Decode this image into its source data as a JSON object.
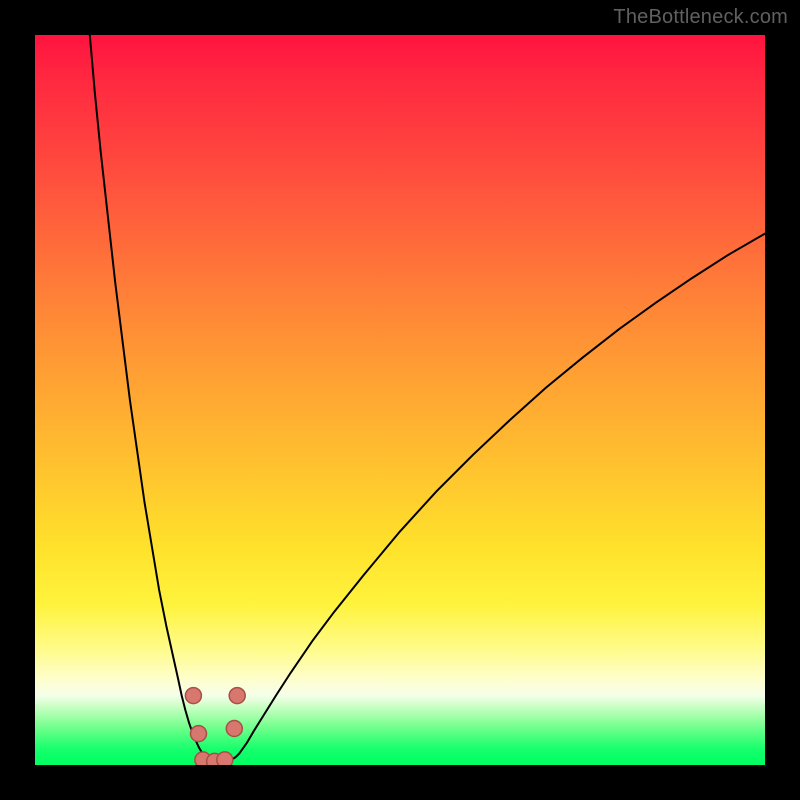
{
  "watermark": "TheBottleneck.com",
  "colors": {
    "page_bg": "#000000",
    "curve": "#000000",
    "marker_fill": "#d8776e",
    "marker_stroke": "#a84f47",
    "gradient_stops": [
      "#ff133f",
      "#ff2840",
      "#ff4a3e",
      "#ff6f3a",
      "#ff9934",
      "#ffbf2f",
      "#ffe12b",
      "#fff33d",
      "#fffb88",
      "#fdfed0",
      "#f4ffe9",
      "#caffc4",
      "#8dff9b",
      "#4dff7e",
      "#13ff6b",
      "#00ff62"
    ]
  },
  "chart_data": {
    "type": "line",
    "title": "",
    "xlabel": "",
    "ylabel": "",
    "xlim": [
      0,
      100
    ],
    "ylim": [
      0,
      100
    ],
    "grid": false,
    "legend": null,
    "background": "vertical-gradient red→yellow→green mapped to y (top=high value, bottom=low value)",
    "x": [
      7.5,
      8.2,
      9.0,
      10.0,
      11.0,
      12.0,
      13.0,
      14.0,
      15.0,
      16.0,
      17.0,
      18.0,
      19.0,
      19.6,
      20.1,
      20.6,
      21.1,
      21.8,
      22.5,
      23.0,
      23.5,
      24.0,
      24.5,
      25.0,
      25.5,
      26.0,
      27.2,
      27.5,
      28.0,
      29.0,
      30.0,
      31.0,
      33.0,
      35.0,
      38.0,
      41.0,
      45.0,
      50.0,
      55.0,
      60.0,
      65.0,
      70.0,
      75.0,
      80.0,
      85.0,
      90.0,
      95.0,
      100.0
    ],
    "values": [
      100.0,
      92.0,
      84.0,
      75.0,
      66.0,
      58.0,
      50.0,
      43.0,
      36.0,
      30.0,
      24.0,
      19.0,
      14.5,
      11.8,
      9.5,
      7.5,
      5.8,
      3.8,
      2.3,
      1.5,
      1.0,
      0.7,
      0.55,
      0.5,
      0.5,
      0.55,
      0.9,
      1.1,
      1.6,
      3.0,
      4.7,
      6.3,
      9.5,
      12.6,
      17.0,
      21.0,
      26.0,
      32.0,
      37.5,
      42.5,
      47.2,
      51.7,
      55.8,
      59.7,
      63.3,
      66.7,
      69.9,
      72.8
    ],
    "annotations": [],
    "markers": [
      {
        "x": 21.7,
        "y": 9.5
      },
      {
        "x": 22.4,
        "y": 4.3
      },
      {
        "x": 23.0,
        "y": 0.7
      },
      {
        "x": 24.6,
        "y": 0.5
      },
      {
        "x": 26.0,
        "y": 0.7
      },
      {
        "x": 27.3,
        "y": 5.0
      },
      {
        "x": 27.7,
        "y": 9.5
      }
    ]
  }
}
